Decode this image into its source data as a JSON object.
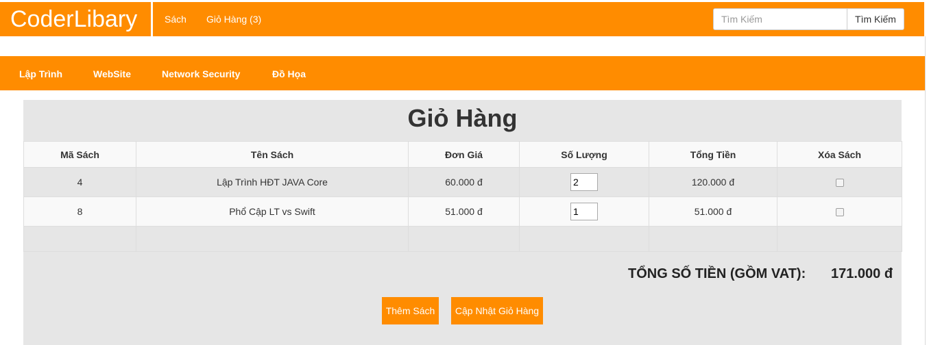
{
  "brand": {
    "title": "CoderLibary"
  },
  "topnav": {
    "books_label": "Sách",
    "cart_label": "Giỏ Hàng (3)"
  },
  "search": {
    "placeholder": "Tìm Kiếm",
    "button_label": "Tìm Kiếm",
    "value": ""
  },
  "categories": [
    {
      "label": "Lập Trình"
    },
    {
      "label": "WebSite"
    },
    {
      "label": "Network Security"
    },
    {
      "label": "Đồ Họa"
    }
  ],
  "cart": {
    "title": "Giỏ Hàng",
    "columns": [
      "Mã Sách",
      "Tên Sách",
      "Đơn Giá",
      "Số Lượng",
      "Tổng Tiền",
      "Xóa Sách"
    ],
    "rows": [
      {
        "id": "4",
        "name": "Lập Trình HĐT JAVA Core",
        "price": "60.000 đ",
        "qty": "2",
        "subtotal": "120.000 đ",
        "delete_checked": false
      },
      {
        "id": "8",
        "name": "Phổ Cập LT vs Swift",
        "price": "51.000 đ",
        "qty": "1",
        "subtotal": "51.000 đ",
        "delete_checked": false
      }
    ],
    "total_label": "TỔNG SỐ TIỀN (GỒM VAT):",
    "total_value": "171.000 đ",
    "add_button_label": "Thêm Sách",
    "update_button_label": "Cập Nhật Giỏ Hàng"
  },
  "colors": {
    "accent": "#ff8c00",
    "panel": "#e6e6e6",
    "stripe": "#f9f9f9"
  }
}
